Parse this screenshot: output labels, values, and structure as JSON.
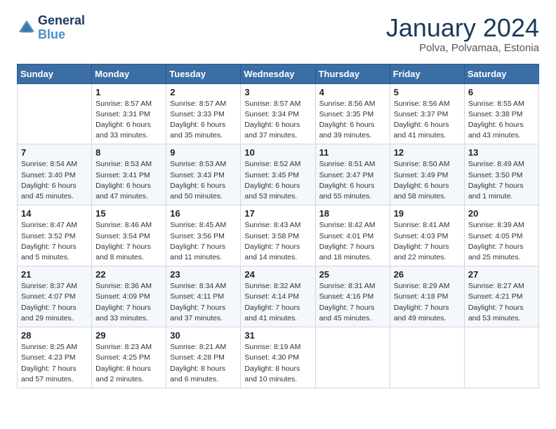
{
  "header": {
    "logo_line1": "General",
    "logo_line2": "Blue",
    "month_title": "January 2024",
    "subtitle": "Polva, Polvamaa, Estonia"
  },
  "days_of_week": [
    "Sunday",
    "Monday",
    "Tuesday",
    "Wednesday",
    "Thursday",
    "Friday",
    "Saturday"
  ],
  "weeks": [
    [
      {
        "day": "",
        "info": ""
      },
      {
        "day": "1",
        "info": "Sunrise: 8:57 AM\nSunset: 3:31 PM\nDaylight: 6 hours\nand 33 minutes."
      },
      {
        "day": "2",
        "info": "Sunrise: 8:57 AM\nSunset: 3:33 PM\nDaylight: 6 hours\nand 35 minutes."
      },
      {
        "day": "3",
        "info": "Sunrise: 8:57 AM\nSunset: 3:34 PM\nDaylight: 6 hours\nand 37 minutes."
      },
      {
        "day": "4",
        "info": "Sunrise: 8:56 AM\nSunset: 3:35 PM\nDaylight: 6 hours\nand 39 minutes."
      },
      {
        "day": "5",
        "info": "Sunrise: 8:56 AM\nSunset: 3:37 PM\nDaylight: 6 hours\nand 41 minutes."
      },
      {
        "day": "6",
        "info": "Sunrise: 8:55 AM\nSunset: 3:38 PM\nDaylight: 6 hours\nand 43 minutes."
      }
    ],
    [
      {
        "day": "7",
        "info": "Sunrise: 8:54 AM\nSunset: 3:40 PM\nDaylight: 6 hours\nand 45 minutes."
      },
      {
        "day": "8",
        "info": "Sunrise: 8:53 AM\nSunset: 3:41 PM\nDaylight: 6 hours\nand 47 minutes."
      },
      {
        "day": "9",
        "info": "Sunrise: 8:53 AM\nSunset: 3:43 PM\nDaylight: 6 hours\nand 50 minutes."
      },
      {
        "day": "10",
        "info": "Sunrise: 8:52 AM\nSunset: 3:45 PM\nDaylight: 6 hours\nand 53 minutes."
      },
      {
        "day": "11",
        "info": "Sunrise: 8:51 AM\nSunset: 3:47 PM\nDaylight: 6 hours\nand 55 minutes."
      },
      {
        "day": "12",
        "info": "Sunrise: 8:50 AM\nSunset: 3:49 PM\nDaylight: 6 hours\nand 58 minutes."
      },
      {
        "day": "13",
        "info": "Sunrise: 8:49 AM\nSunset: 3:50 PM\nDaylight: 7 hours\nand 1 minute."
      }
    ],
    [
      {
        "day": "14",
        "info": "Sunrise: 8:47 AM\nSunset: 3:52 PM\nDaylight: 7 hours\nand 5 minutes."
      },
      {
        "day": "15",
        "info": "Sunrise: 8:46 AM\nSunset: 3:54 PM\nDaylight: 7 hours\nand 8 minutes."
      },
      {
        "day": "16",
        "info": "Sunrise: 8:45 AM\nSunset: 3:56 PM\nDaylight: 7 hours\nand 11 minutes."
      },
      {
        "day": "17",
        "info": "Sunrise: 8:43 AM\nSunset: 3:58 PM\nDaylight: 7 hours\nand 14 minutes."
      },
      {
        "day": "18",
        "info": "Sunrise: 8:42 AM\nSunset: 4:01 PM\nDaylight: 7 hours\nand 18 minutes."
      },
      {
        "day": "19",
        "info": "Sunrise: 8:41 AM\nSunset: 4:03 PM\nDaylight: 7 hours\nand 22 minutes."
      },
      {
        "day": "20",
        "info": "Sunrise: 8:39 AM\nSunset: 4:05 PM\nDaylight: 7 hours\nand 25 minutes."
      }
    ],
    [
      {
        "day": "21",
        "info": "Sunrise: 8:37 AM\nSunset: 4:07 PM\nDaylight: 7 hours\nand 29 minutes."
      },
      {
        "day": "22",
        "info": "Sunrise: 8:36 AM\nSunset: 4:09 PM\nDaylight: 7 hours\nand 33 minutes."
      },
      {
        "day": "23",
        "info": "Sunrise: 8:34 AM\nSunset: 4:11 PM\nDaylight: 7 hours\nand 37 minutes."
      },
      {
        "day": "24",
        "info": "Sunrise: 8:32 AM\nSunset: 4:14 PM\nDaylight: 7 hours\nand 41 minutes."
      },
      {
        "day": "25",
        "info": "Sunrise: 8:31 AM\nSunset: 4:16 PM\nDaylight: 7 hours\nand 45 minutes."
      },
      {
        "day": "26",
        "info": "Sunrise: 8:29 AM\nSunset: 4:18 PM\nDaylight: 7 hours\nand 49 minutes."
      },
      {
        "day": "27",
        "info": "Sunrise: 8:27 AM\nSunset: 4:21 PM\nDaylight: 7 hours\nand 53 minutes."
      }
    ],
    [
      {
        "day": "28",
        "info": "Sunrise: 8:25 AM\nSunset: 4:23 PM\nDaylight: 7 hours\nand 57 minutes."
      },
      {
        "day": "29",
        "info": "Sunrise: 8:23 AM\nSunset: 4:25 PM\nDaylight: 8 hours\nand 2 minutes."
      },
      {
        "day": "30",
        "info": "Sunrise: 8:21 AM\nSunset: 4:28 PM\nDaylight: 8 hours\nand 6 minutes."
      },
      {
        "day": "31",
        "info": "Sunrise: 8:19 AM\nSunset: 4:30 PM\nDaylight: 8 hours\nand 10 minutes."
      },
      {
        "day": "",
        "info": ""
      },
      {
        "day": "",
        "info": ""
      },
      {
        "day": "",
        "info": ""
      }
    ]
  ]
}
